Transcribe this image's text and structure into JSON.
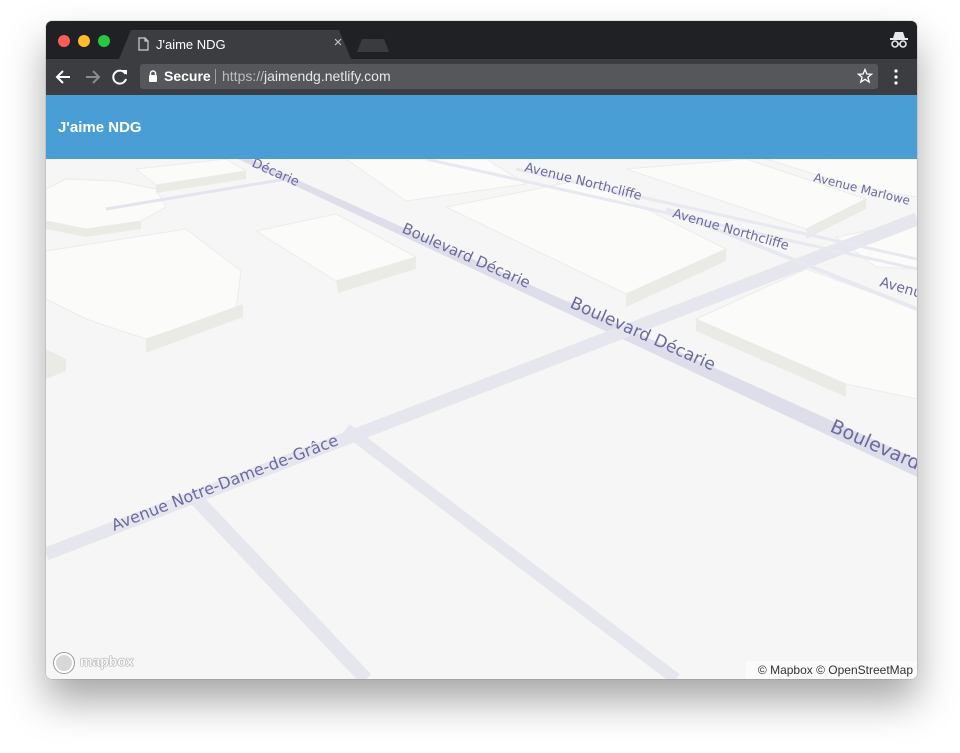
{
  "browser": {
    "tab": {
      "title": "J'aime NDG",
      "close_label": "×"
    },
    "address_bar": {
      "secure_label": "Secure",
      "url_scheme": "https://",
      "url_host": "jaimendg.netlify.com"
    },
    "icons": [
      "page-icon",
      "close-icon",
      "incognito-icon",
      "back-icon",
      "forward-icon",
      "reload-icon",
      "lock-icon",
      "star-icon",
      "menu-icon"
    ]
  },
  "app": {
    "title": "J'aime NDG",
    "header_color": "#4a9ed6"
  },
  "map": {
    "labels": {
      "decarie_top": "Décarie",
      "decarie_1": "Boulevard Décarie",
      "decarie_2": "Boulevard Décarie",
      "decarie_3": "Boulevard",
      "northcliffe_1": "Avenue Northcliffe",
      "northcliffe_2": "Avenue Northcliffe",
      "marlowe": "Avenue Marlowe",
      "avenue_right": "Avenu",
      "ndg": "Avenue Notre-Dame-de-Grâce"
    },
    "logo": "mapbox",
    "attribution": "© Mapbox © OpenStreetMap"
  }
}
